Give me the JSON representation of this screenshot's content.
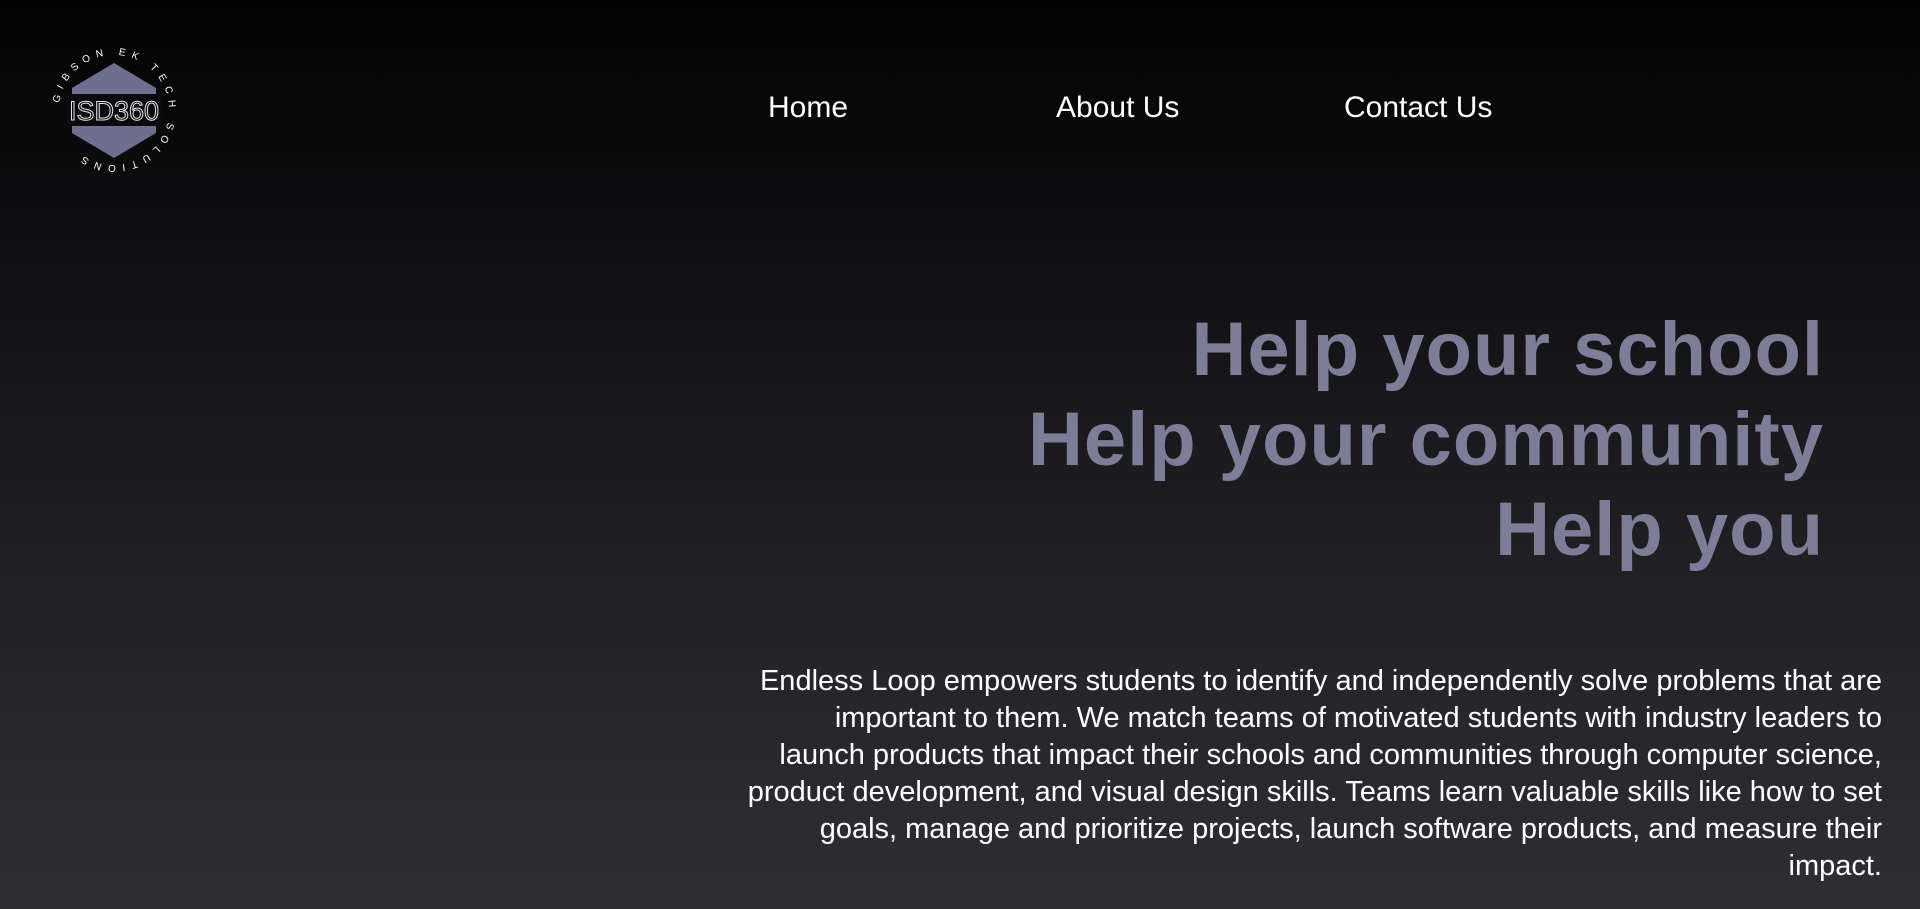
{
  "logo": {
    "icon": "hexagon-badge-logo",
    "center_text": "ISD360",
    "ring_text": "GIBSON EK TECH SOLUTIONS",
    "accent_color": "#6e6f8f"
  },
  "nav": {
    "items": [
      {
        "label": "Home"
      },
      {
        "label": "About Us"
      },
      {
        "label": "Contact Us"
      }
    ]
  },
  "hero": {
    "lines": [
      "Help your school",
      "Help your community",
      "Help you"
    ],
    "color": "#7d7d98"
  },
  "description": {
    "text": "Endless Loop empowers students to identify and independently solve problems that are important to them. We match teams of motivated students with industry leaders to launch products that impact their schools and communities through computer science, product development, and visual design skills. Teams learn valuable skills like how to set goals, manage and prioritize projects, launch software products, and measure their impact."
  }
}
